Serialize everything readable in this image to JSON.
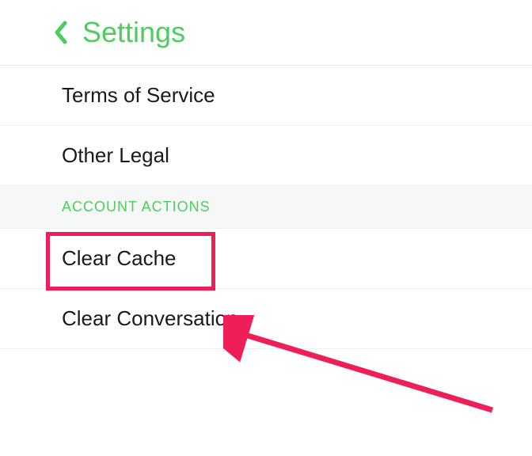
{
  "header": {
    "title": "Settings"
  },
  "items": {
    "terms_of_service": "Terms of Service",
    "other_legal": "Other Legal",
    "clear_cache": "Clear Cache",
    "clear_conversation": "Clear Conversation"
  },
  "section": {
    "account_actions": "ACCOUNT ACTIONS"
  },
  "colors": {
    "accent": "#4ecd5e",
    "highlight": "#ed1e58"
  }
}
